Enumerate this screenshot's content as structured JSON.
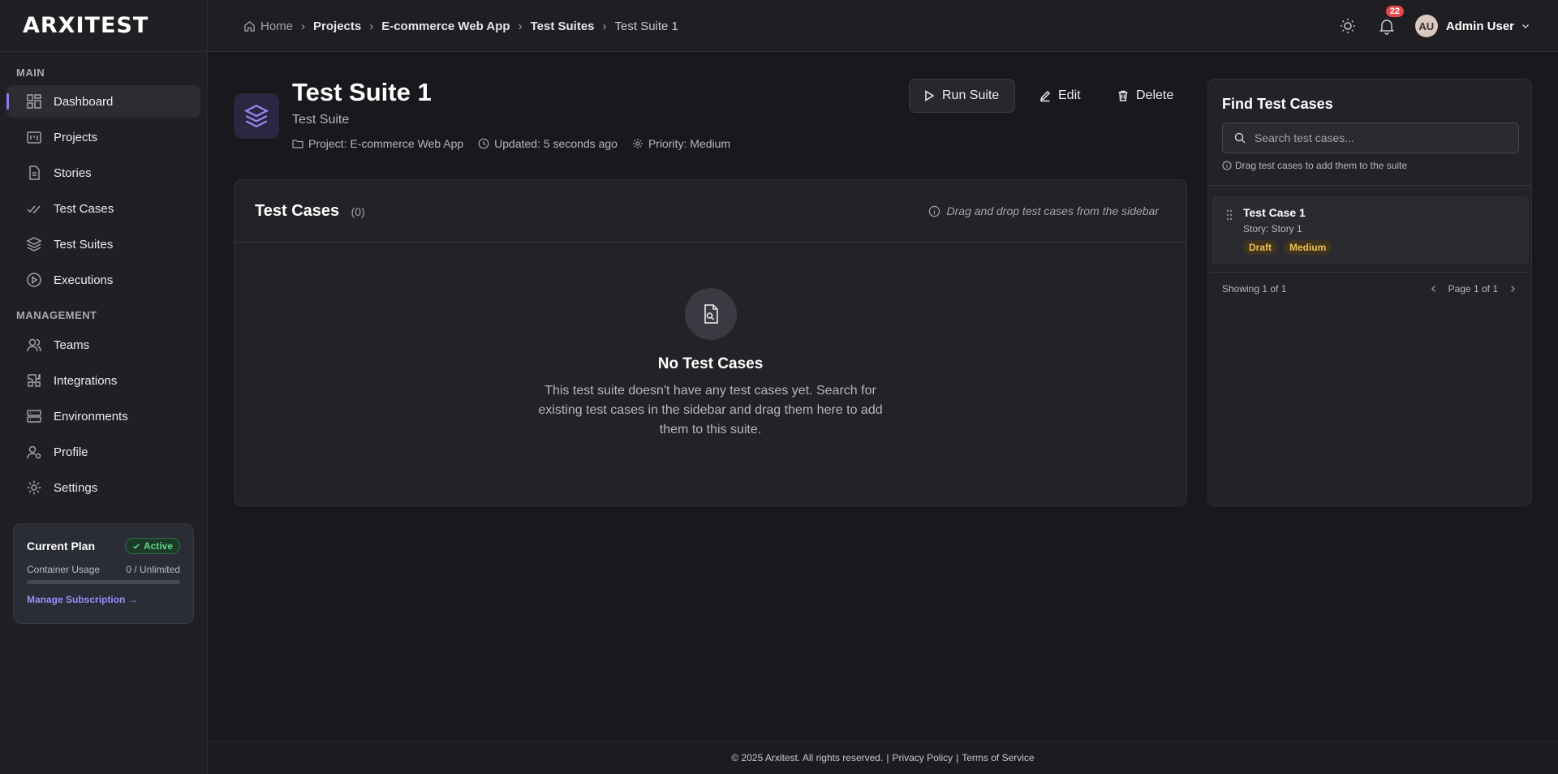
{
  "app": {
    "logo": "ARXITEST"
  },
  "sidebar": {
    "sections": [
      {
        "label": "MAIN"
      },
      {
        "label": "MANAGEMENT"
      }
    ],
    "main_items": [
      {
        "label": "Dashboard",
        "icon": "dashboard-icon",
        "active": true
      },
      {
        "label": "Projects",
        "icon": "projects-icon"
      },
      {
        "label": "Stories",
        "icon": "stories-icon"
      },
      {
        "label": "Test Cases",
        "icon": "test-cases-icon"
      },
      {
        "label": "Test Suites",
        "icon": "test-suites-icon"
      },
      {
        "label": "Executions",
        "icon": "executions-icon"
      }
    ],
    "management_items": [
      {
        "label": "Teams",
        "icon": "teams-icon"
      },
      {
        "label": "Integrations",
        "icon": "integrations-icon"
      },
      {
        "label": "Environments",
        "icon": "environments-icon"
      },
      {
        "label": "Profile",
        "icon": "profile-icon"
      },
      {
        "label": "Settings",
        "icon": "settings-icon"
      }
    ],
    "plan": {
      "title": "Current Plan",
      "badge": "Active",
      "usage_label": "Container Usage",
      "usage_value": "0 / Unlimited",
      "usage_fraction": 0,
      "link": "Manage Subscription →"
    }
  },
  "header": {
    "breadcrumb": [
      "Home",
      "Projects",
      "E-commerce Web App",
      "Test Suites",
      "Test Suite 1"
    ],
    "notifications_count": "22",
    "user": {
      "initials": "AU",
      "name": "Admin User"
    }
  },
  "suite": {
    "title": "Test Suite 1",
    "subtitle": "Test Suite",
    "project": "Project: E-commerce Web App",
    "updated": "Updated: 5 seconds ago",
    "priority": "Priority: Medium",
    "actions": {
      "run": "Run Suite",
      "edit": "Edit",
      "delete": "Delete"
    }
  },
  "test_cases_card": {
    "title": "Test Cases",
    "count": "(0)",
    "hint": "Drag and drop test cases from the sidebar",
    "empty_title": "No Test Cases",
    "empty_text": "This test suite doesn't have any test cases yet. Search for existing test cases in the sidebar and drag them here to add them to this suite."
  },
  "finder": {
    "title": "Find Test Cases",
    "search_placeholder": "Search test cases...",
    "hint": "Drag test cases to add them to the suite",
    "items": [
      {
        "title": "Test Case 1",
        "story": "Story: Story 1",
        "tags": [
          "Draft",
          "Medium"
        ]
      }
    ],
    "showing": "Showing 1 of 1",
    "page": "Page 1 of 1"
  },
  "footer": {
    "copyright": "© 2025 Arxitest. All rights reserved.",
    "privacy": "Privacy Policy",
    "terms": "Terms of Service"
  },
  "colors": {
    "accent": "#8b7cf6",
    "active_badge": "#5ed48a",
    "notification": "#e5484d",
    "tag": "#f2c14e"
  }
}
